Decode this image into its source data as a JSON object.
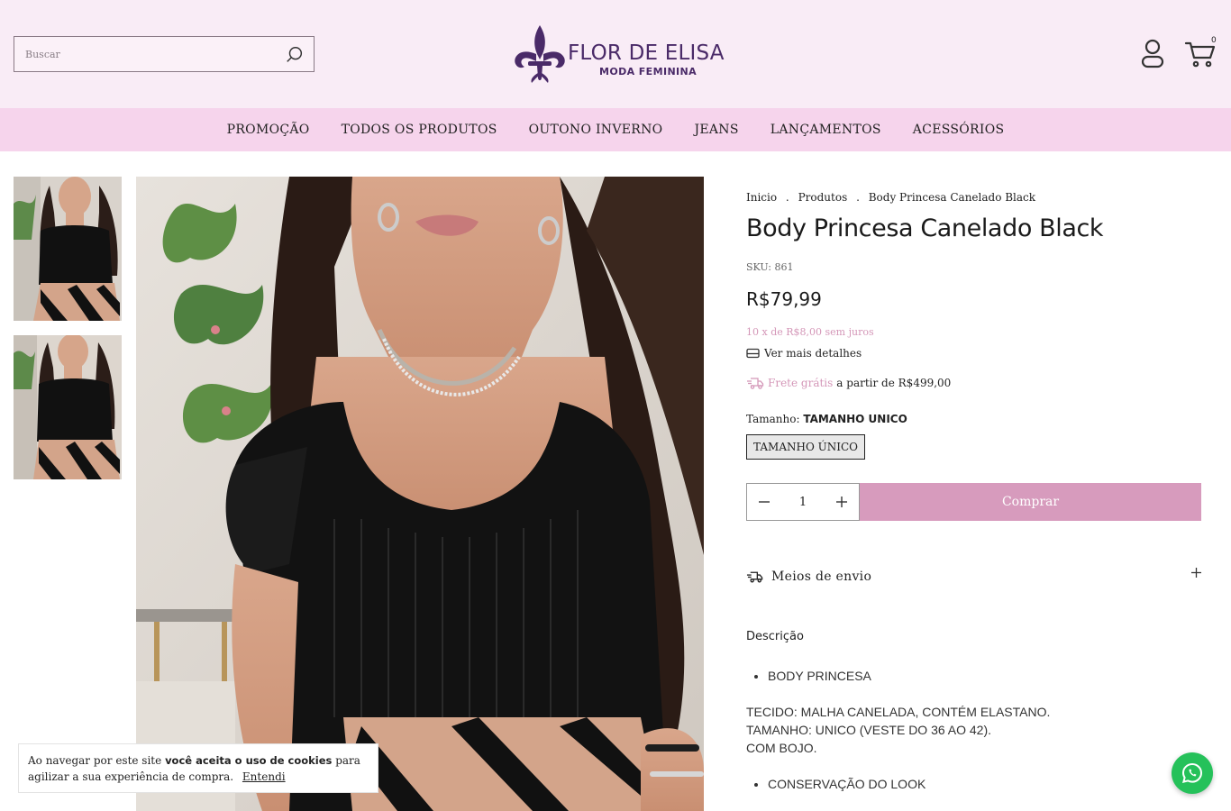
{
  "header": {
    "search_placeholder": "Buscar",
    "logo_title": "FLOR DE ELISA",
    "logo_subtitle": "MODA FEMININA",
    "cart_count": "0"
  },
  "nav": {
    "items": [
      {
        "label": "PROMOÇÃO"
      },
      {
        "label": "TODOS OS PRODUTOS"
      },
      {
        "label": "OUTONO INVERNO"
      },
      {
        "label": "JEANS"
      },
      {
        "label": "LANÇAMENTOS"
      },
      {
        "label": "ACESSÓRIOS"
      }
    ]
  },
  "breadcrumb": {
    "home": "Inicio",
    "products": "Produtos",
    "current": "Body Princesa Canelado Black",
    "separator": "."
  },
  "product": {
    "title": "Body Princesa Canelado Black",
    "sku": "SKU: 861",
    "price": "R$79,99",
    "installments": "10 x de R$8,00 sem juros",
    "details_link": "Ver mais detalhes",
    "free_shipping": "Frete grátis",
    "free_shipping_threshold": "a partir de R$499,00",
    "size_label": "Tamanho:",
    "size_selected": "TAMANHO UNICO",
    "size_option": "TAMANHO ÚNICO",
    "quantity": "1",
    "buy_label": "Comprar",
    "shipping_methods_label": "Meios de envio"
  },
  "description": {
    "title": "Descrição",
    "bullet1": "BODY PRINCESA",
    "line1": "TECIDO: MALHA CANELADA, CONTÉM ELASTANO.",
    "line2": "TAMANHO: UNICO (VESTE DO 36 AO 42).",
    "line3": "COM BOJO.",
    "bullet2": "CONSERVAÇÃO DO LOOK"
  },
  "cookie": {
    "text_before": "Ao navegar por este site",
    "text_bold": "você aceita o uso de cookies",
    "text_after": "para agilizar a sua experiência de compra.",
    "accept_label": "Entendi"
  },
  "icons": {
    "search": "search-icon",
    "user": "user-icon",
    "cart": "cart-icon",
    "card": "credit-card-icon",
    "truck": "truck-icon",
    "plus": "plus-icon",
    "minus": "minus-icon",
    "whatsapp": "whatsapp-icon"
  },
  "colors": {
    "header_bg": "#f9ecf6",
    "nav_bg": "#f6d4ec",
    "accent_pink": "#d79bbd",
    "brand_purple": "#4a2a68",
    "whatsapp_green": "#25c15a"
  }
}
